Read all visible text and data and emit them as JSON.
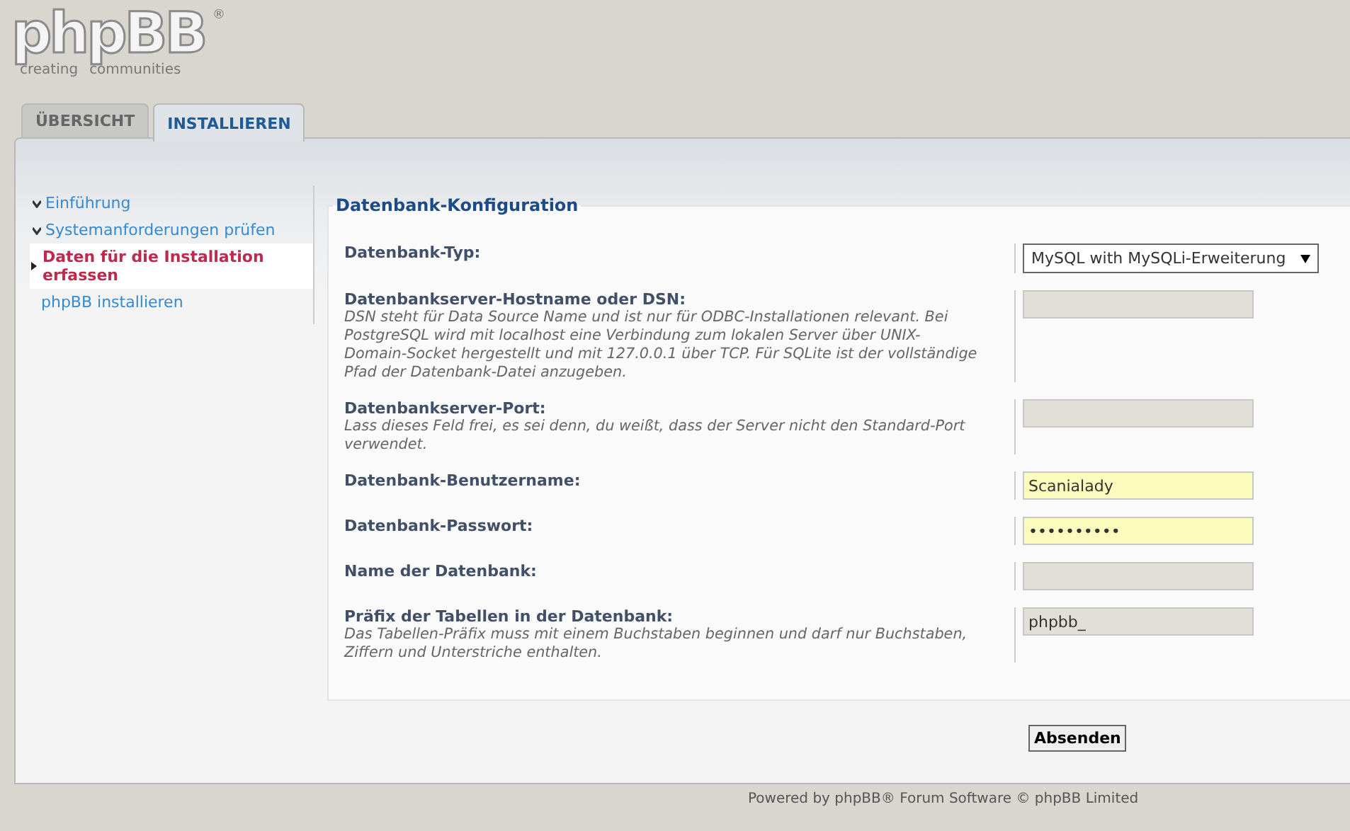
{
  "logo": {
    "wordmark": "phpBB",
    "registered": "®",
    "tagline_1": "creating",
    "tagline_2": "communities"
  },
  "tabs": [
    {
      "label": "ÜBERSICHT",
      "selected": false
    },
    {
      "label": "INSTALLIEREN",
      "selected": true
    }
  ],
  "sidebar": {
    "items": [
      {
        "label": "Einführung",
        "done": true,
        "selected": false
      },
      {
        "label": "Systemanforderungen prüfen",
        "done": true,
        "selected": false
      },
      {
        "label": "Daten für die Installation erfassen",
        "done": false,
        "selected": true
      },
      {
        "label": "phpBB installieren",
        "done": false,
        "selected": false
      }
    ]
  },
  "form": {
    "legend": "Datenbank-Konfiguration",
    "fields": [
      {
        "label": "Datenbank-Typ:",
        "kind": "select",
        "value": "MySQL with MySQLi-Erweiterung"
      },
      {
        "label": "Datenbankserver-Hostname oder DSN:",
        "explain": "DSN steht für Data Source Name und ist nur für ODBC-Installationen relevant. Bei PostgreSQL wird mit localhost eine Verbindung zum lokalen Server über UNIX-Domain-Socket hergestellt und mit 127.0.0.1 über TCP. Für SQLite ist der vollständige Pfad der Datenbank-Datei anzugeben.",
        "kind": "text",
        "highlighted": false
      },
      {
        "label": "Datenbankserver-Port:",
        "explain": "Lass dieses Feld frei, es sei denn, du weißt, dass der Server nicht den Standard-Port verwendet.",
        "kind": "text",
        "highlighted": false
      },
      {
        "label": "Datenbank-Benutzername:",
        "kind": "text",
        "value": "Scanialady",
        "highlighted": true
      },
      {
        "label": "Datenbank-Passwort:",
        "kind": "password",
        "value": "••••••••••",
        "highlighted": true
      },
      {
        "label": "Name der Datenbank:",
        "kind": "text",
        "highlighted": false
      },
      {
        "label": "Präfix der Tabellen in der Datenbank:",
        "explain": "Das Tabellen-Präfix muss mit einem Buchstaben beginnen und darf nur Buchstaben, Ziffern und Unterstriche enthalten.",
        "kind": "text",
        "value": "phpbb_",
        "highlighted": false
      }
    ]
  },
  "submit": "Absenden",
  "footer": "Powered by phpBB® Forum Software © phpBB Limited"
}
